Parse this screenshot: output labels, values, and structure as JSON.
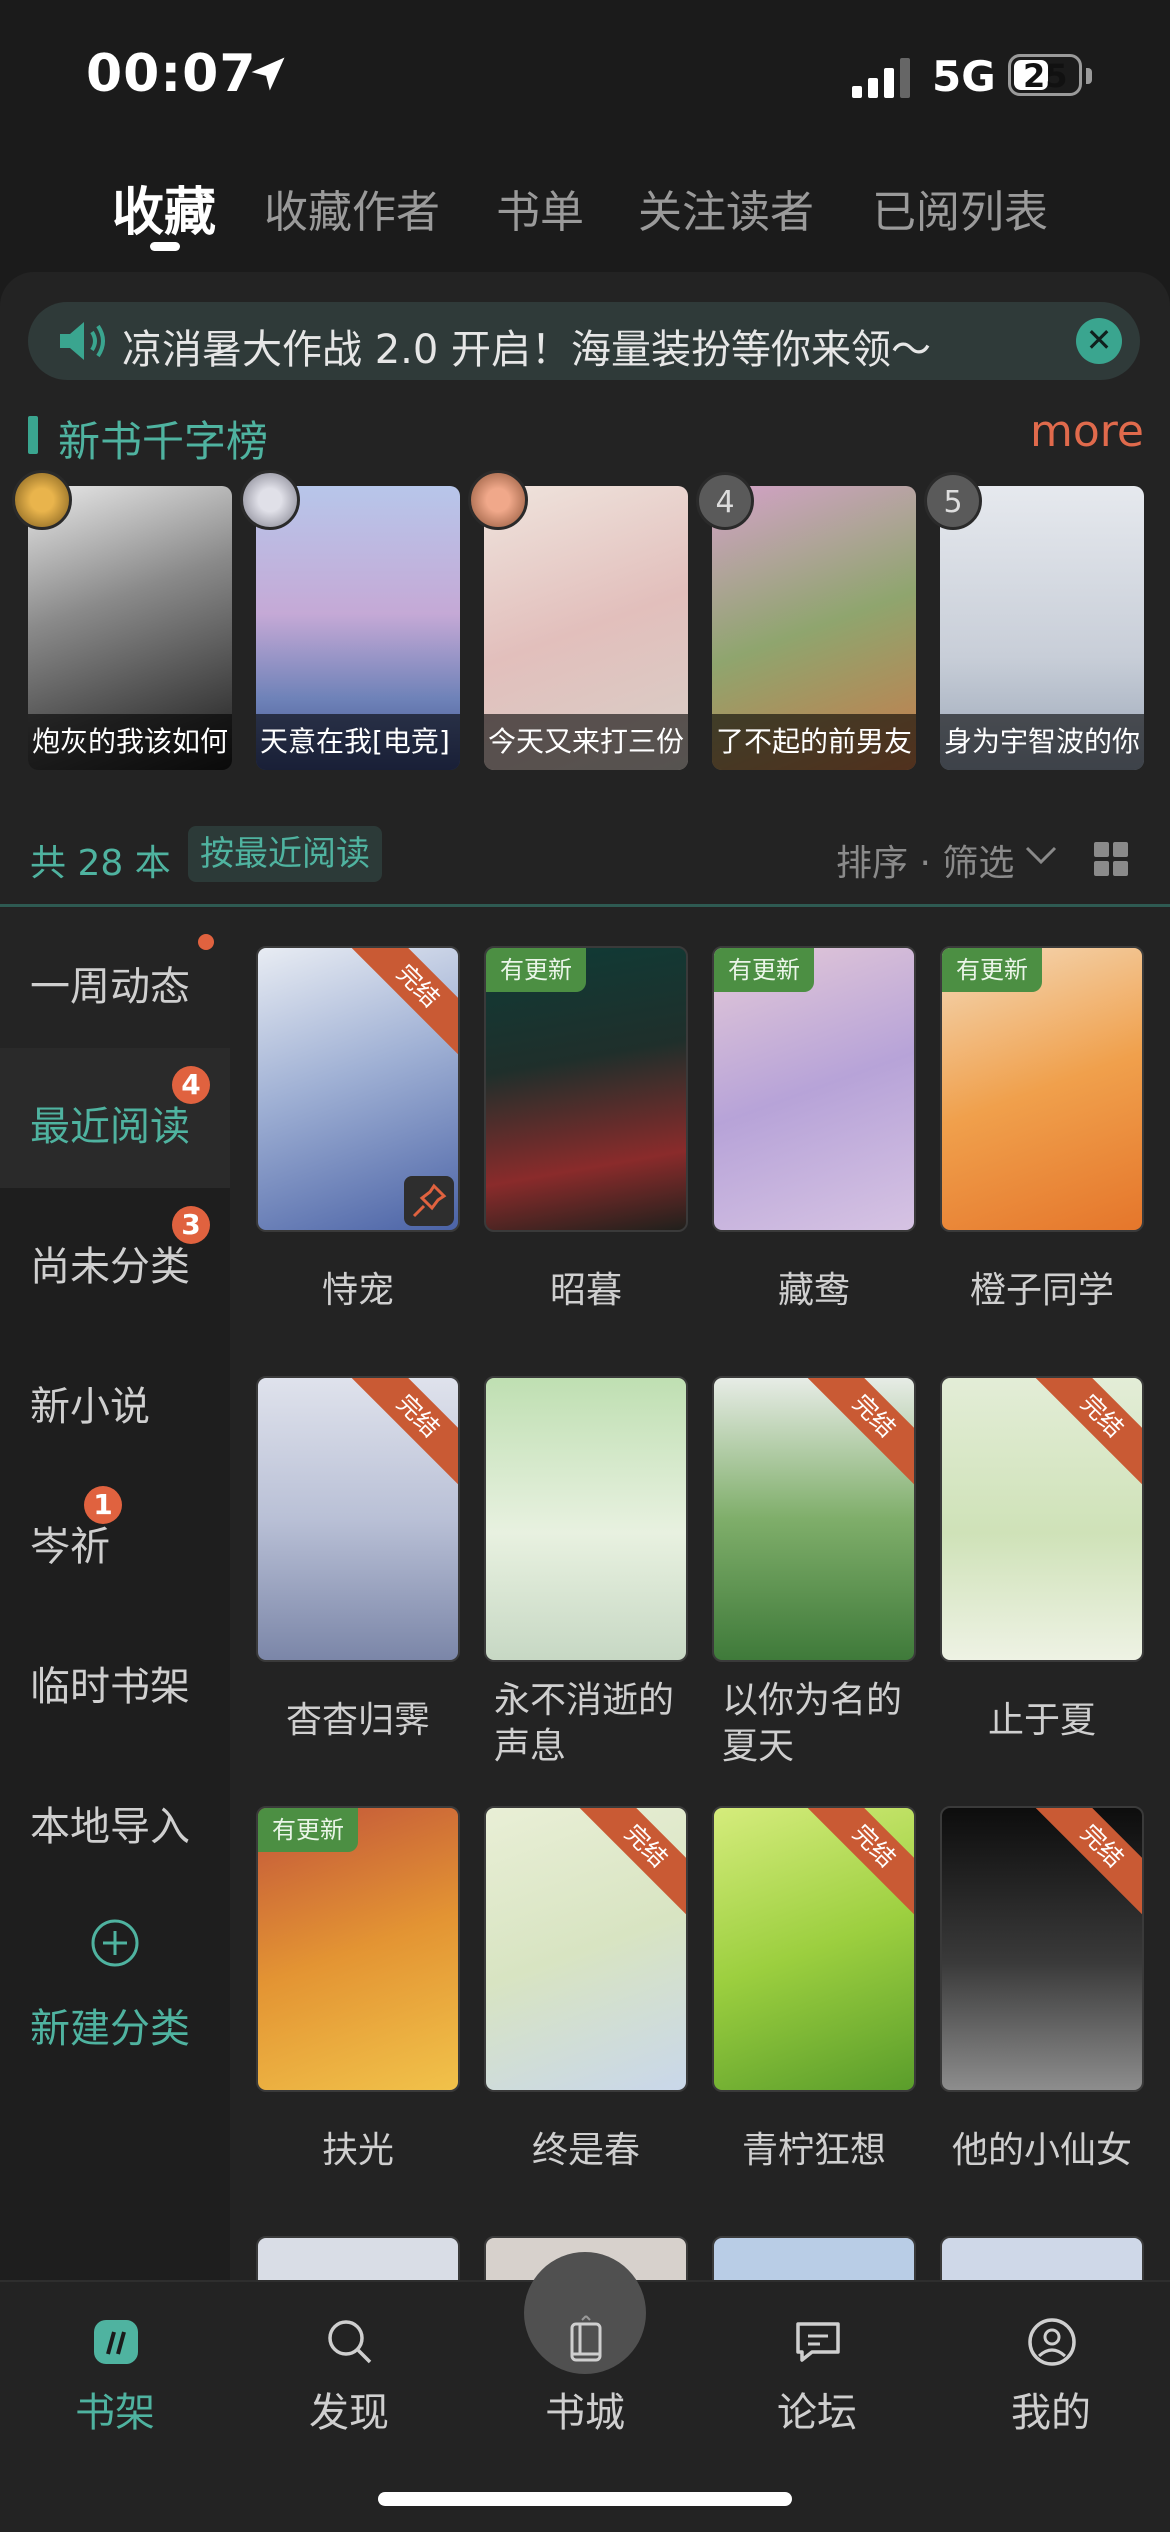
{
  "status": {
    "time": "00:07",
    "network": "5G",
    "battery": "25"
  },
  "top_tabs": [
    {
      "label": "收藏"
    },
    {
      "label": "收藏作者"
    },
    {
      "label": "书单"
    },
    {
      "label": "关注读者"
    },
    {
      "label": "已阅列表"
    }
  ],
  "notice": {
    "text": "凉消暑大作战 2.0 开启！海量装扮等你来领～"
  },
  "ranking": {
    "title": "新书千字榜",
    "more": "more",
    "items": [
      {
        "title": "炮灰的我该如何",
        "rank": "1"
      },
      {
        "title": "天意在我[电竞]",
        "rank": "2"
      },
      {
        "title": "今天又来打三份",
        "rank": "3"
      },
      {
        "title": "了不起的前男友",
        "rank": "4"
      },
      {
        "title": "身为宇智波的你",
        "rank": "5"
      }
    ]
  },
  "filter": {
    "count": "共 28 本",
    "sort_chip": "按最近阅读",
    "sort_menu": "排序 · 筛选"
  },
  "sidebar": {
    "items": [
      {
        "label": "一周动态"
      },
      {
        "label": "最近阅读",
        "badge": "4"
      },
      {
        "label": "尚未分类",
        "badge": "3"
      },
      {
        "label": "新小说"
      },
      {
        "label": "岑祈",
        "badge": "1"
      },
      {
        "label": "临时书架"
      },
      {
        "label": "本地导入"
      }
    ],
    "new_category": "新建分类"
  },
  "books": [
    {
      "title": "恃宠",
      "tag": "完结"
    },
    {
      "title": "昭暮",
      "tag": "有更新"
    },
    {
      "title": "藏鸯",
      "tag": "有更新"
    },
    {
      "title": "橙子同学",
      "tag": "有更新"
    },
    {
      "title": "杳杳归霁",
      "tag": "完结"
    },
    {
      "title": "永不消逝的声息",
      "title_l1": "永不消逝的",
      "title_l2": "声息",
      "tag": ""
    },
    {
      "title": "以你为名的夏天",
      "title_l1": "以你为名的",
      "title_l2": "夏天",
      "tag": "完结"
    },
    {
      "title": "止于夏",
      "tag": "完结"
    },
    {
      "title": "扶光",
      "tag": "有更新"
    },
    {
      "title": "终是春",
      "tag": "完结"
    },
    {
      "title": "青柠狂想",
      "tag": "完结"
    },
    {
      "title": "他的小仙女",
      "tag": "完结"
    }
  ],
  "bottom_nav": [
    {
      "label": "书架"
    },
    {
      "label": "发现"
    },
    {
      "label": "书城"
    },
    {
      "label": "论坛"
    },
    {
      "label": "我的"
    }
  ],
  "colors": {
    "accent": "#4fb3a0",
    "more": "#e06a4c",
    "badge": "#e0623f",
    "update_tag": "#4c8f43",
    "done_tag": "#c95a34"
  }
}
